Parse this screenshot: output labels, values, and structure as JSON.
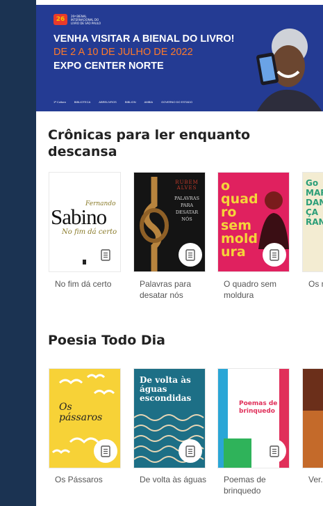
{
  "banner": {
    "logo_mark": "26",
    "logo_text": "26ª BIENAL INTERNACIONAL DO LIVRO DE SÃO PAULO",
    "line1": "VENHA VISITAR A BIENAL DO LIVRO!",
    "line2": "DE 2 A 10 DE JULHO DE 2022",
    "line3": "EXPO CENTER NORTE",
    "sponsors": [
      "1ª Cultura",
      "BIBLIOTECA",
      "ABRELIVROS",
      "BIBLION",
      "AMBIA",
      "GOVERNO DO ESTADO"
    ]
  },
  "sections": [
    {
      "title": "Crônicas para ler enquanto descansa",
      "books": [
        {
          "title": "No fim dá certo",
          "cover_author": "Fernando",
          "cover_title": "Sabino",
          "cover_subtitle": "No fim dá certo"
        },
        {
          "title": "Palavras para desatar nós",
          "cover_author": "RUBEM ALVES",
          "cover_title": "PALAVRAS PARA DESATAR NÓS"
        },
        {
          "title": "O quadro sem moldura",
          "cover_title": "o quadro sem moldura"
        },
        {
          "title": "Os m... dan...",
          "cover_title": "Go MAR DAN ÇA RAN"
        }
      ]
    },
    {
      "title": "Poesia Todo Dia",
      "books": [
        {
          "title": "Os Pássaros",
          "cover_title": "Os pássaros"
        },
        {
          "title": "De volta às águas",
          "cover_title": "De volta às águas escondidas"
        },
        {
          "title": "Poemas de brinquedo",
          "cover_title": "Poemas de brinquedo"
        },
        {
          "title": "Ver..."
        }
      ]
    }
  ],
  "icons": {
    "book_badge": "book-icon"
  },
  "colors": {
    "banner_bg": "#243b93",
    "accent_orange": "#ff7a2a",
    "page_bg": "#152a46"
  }
}
